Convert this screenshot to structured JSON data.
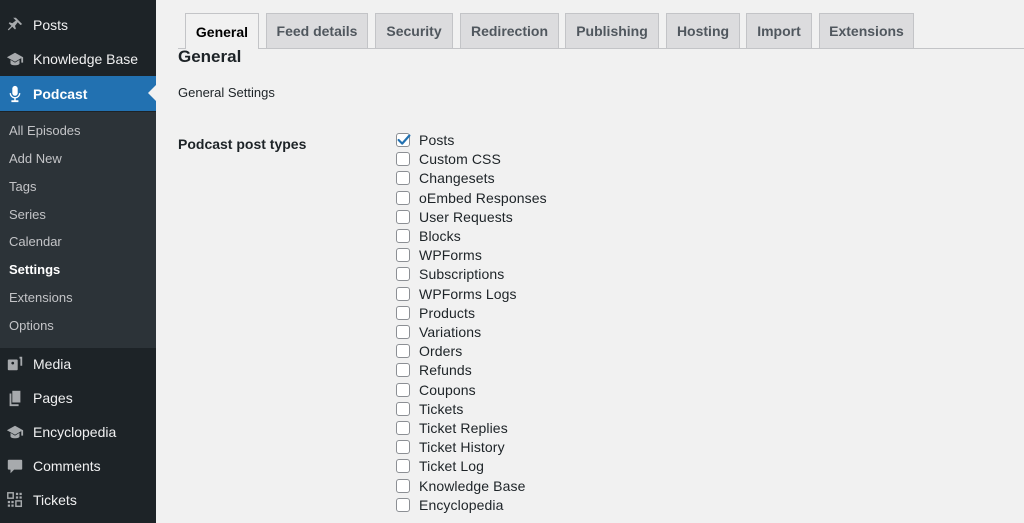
{
  "sidebar": {
    "items_top": [
      {
        "label": "Posts",
        "icon": "pin-icon"
      },
      {
        "label": "Knowledge Base",
        "icon": "graduation-cap-icon"
      },
      {
        "label": "Podcast",
        "icon": "microphone-icon",
        "active": true
      }
    ],
    "submenu": [
      {
        "label": "All Episodes"
      },
      {
        "label": "Add New"
      },
      {
        "label": "Tags"
      },
      {
        "label": "Series"
      },
      {
        "label": "Calendar"
      },
      {
        "label": "Settings",
        "current": true
      },
      {
        "label": "Extensions"
      },
      {
        "label": "Options"
      }
    ],
    "items_bottom": [
      {
        "label": "Media",
        "icon": "media-icon"
      },
      {
        "label": "Pages",
        "icon": "pages-icon"
      },
      {
        "label": "Encyclopedia",
        "icon": "graduation-cap-icon"
      },
      {
        "label": "Comments",
        "icon": "comment-bubble-icon"
      },
      {
        "label": "Tickets",
        "icon": "grid-icon"
      }
    ]
  },
  "tabs": [
    {
      "label": "General",
      "active": true
    },
    {
      "label": "Feed details"
    },
    {
      "label": "Security"
    },
    {
      "label": "Redirection"
    },
    {
      "label": "Publishing"
    },
    {
      "label": "Hosting"
    },
    {
      "label": "Import"
    },
    {
      "label": "Extensions"
    }
  ],
  "page": {
    "title": "General",
    "section_description": "General Settings",
    "field_label": "Podcast post types"
  },
  "post_types": [
    {
      "label": "Posts",
      "checked": true
    },
    {
      "label": "Custom CSS",
      "checked": false
    },
    {
      "label": "Changesets",
      "checked": false
    },
    {
      "label": "oEmbed Responses",
      "checked": false
    },
    {
      "label": "User Requests",
      "checked": false
    },
    {
      "label": "Blocks",
      "checked": false
    },
    {
      "label": "WPForms",
      "checked": false
    },
    {
      "label": "Subscriptions",
      "checked": false
    },
    {
      "label": "WPForms Logs",
      "checked": false
    },
    {
      "label": "Products",
      "checked": false
    },
    {
      "label": "Variations",
      "checked": false
    },
    {
      "label": "Orders",
      "checked": false
    },
    {
      "label": "Refunds",
      "checked": false
    },
    {
      "label": "Coupons",
      "checked": false
    },
    {
      "label": "Tickets",
      "checked": false
    },
    {
      "label": "Ticket Replies",
      "checked": false
    },
    {
      "label": "Ticket History",
      "checked": false
    },
    {
      "label": "Ticket Log",
      "checked": false
    },
    {
      "label": "Knowledge Base",
      "checked": false
    },
    {
      "label": "Encyclopedia",
      "checked": false
    }
  ],
  "colors": {
    "sidebar_bg": "#1d2327",
    "submenu_bg": "#2c3338",
    "accent": "#2271b1",
    "page_bg": "#f1f1f1"
  }
}
